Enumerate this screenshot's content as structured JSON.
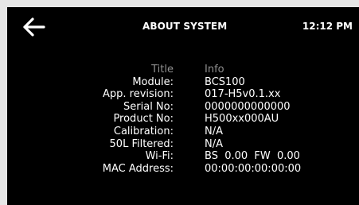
{
  "header": {
    "title": "ABOUT SYSTEM",
    "time": "12:12 PM",
    "back_icon": "arrow-left-icon"
  },
  "table": {
    "header": {
      "label": "Title",
      "value": "Info"
    },
    "rows": [
      {
        "label": "Module:",
        "value": "BCS100"
      },
      {
        "label": "App. revision:",
        "value": "017-H5v0.1.xx"
      },
      {
        "label": "Serial No:",
        "value": "0000000000000"
      },
      {
        "label": "Product No:",
        "value": "H500xx000AU"
      },
      {
        "label": "Calibration:",
        "value": "N/A"
      },
      {
        "label": "50L Filtered:",
        "value": "N/A"
      },
      {
        "label": "Wi-Fi:",
        "value": "BS  0.00  FW  0.00"
      },
      {
        "label": "MAC Address:",
        "value": "00:00:00:00:00:00"
      }
    ]
  },
  "colors": {
    "screen_background": "#000000",
    "text": "#ffffff",
    "header_row_text": "#8f8f8f",
    "frame": "#e6e6e6"
  }
}
